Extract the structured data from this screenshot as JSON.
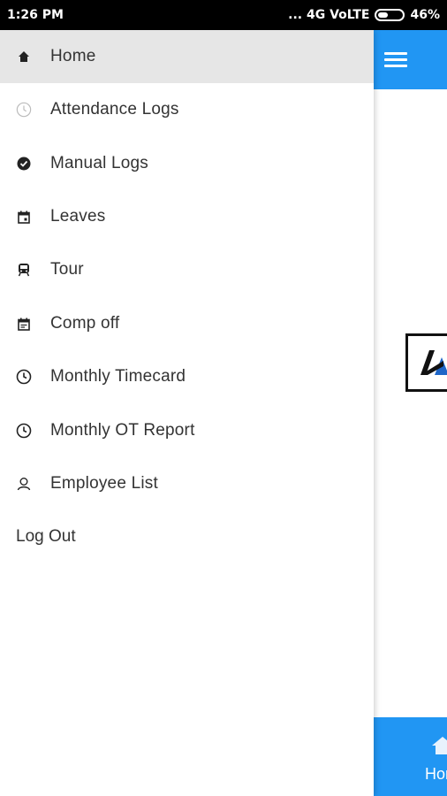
{
  "status_bar": {
    "time": "1:26 PM",
    "indicators": "... 4G VoLTE",
    "battery": "46%"
  },
  "drawer": {
    "items": [
      {
        "label": "Home",
        "icon": "home-icon",
        "active": true
      },
      {
        "label": "Attendance Logs",
        "icon": "clock-outline-icon"
      },
      {
        "label": "Manual Logs",
        "icon": "check-circle-icon"
      },
      {
        "label": "Leaves",
        "icon": "calendar-event-icon"
      },
      {
        "label": "Tour",
        "icon": "train-icon"
      },
      {
        "label": "Comp off",
        "icon": "calendar-note-icon"
      },
      {
        "label": "Monthly Timecard",
        "icon": "clock-icon"
      },
      {
        "label": "Monthly OT Report",
        "icon": "clock-icon"
      },
      {
        "label": "Employee List",
        "icon": "person-icon"
      }
    ],
    "logout_label": "Log Out"
  },
  "app": {
    "bottom_nav_label": "Hom",
    "accent": "#2196F3"
  }
}
